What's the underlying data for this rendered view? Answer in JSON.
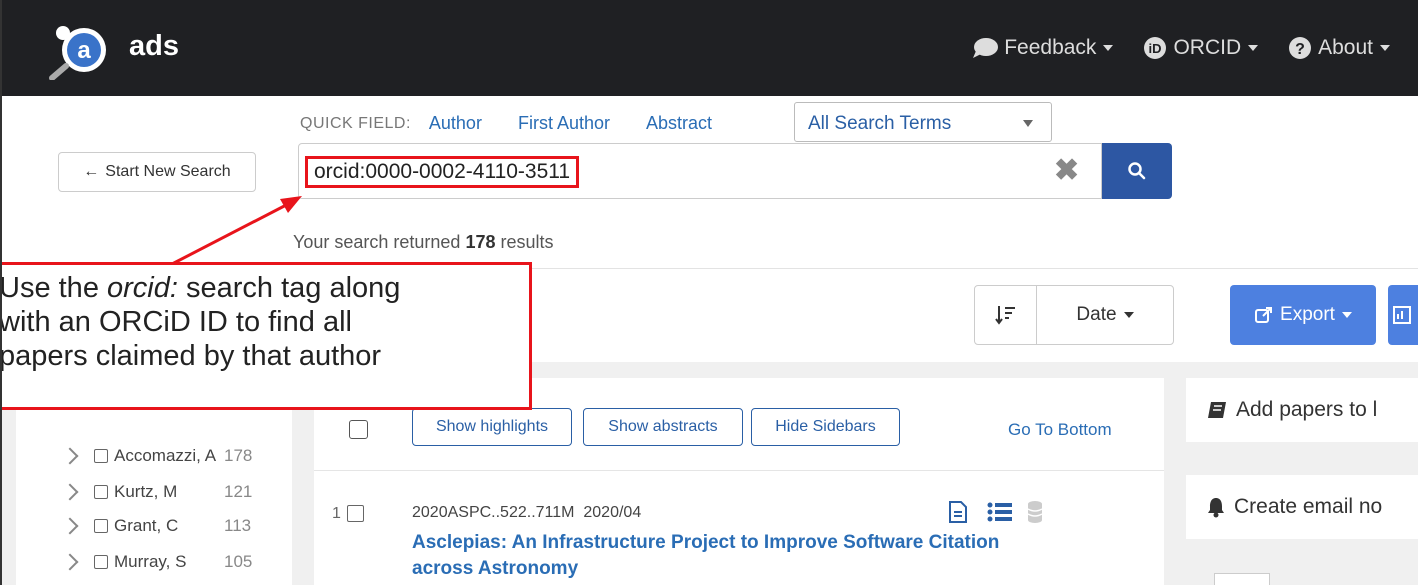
{
  "nav": {
    "logo_text": "ads",
    "feedback": "Feedback",
    "orcid": "ORCID",
    "about": "About"
  },
  "search": {
    "quick_label": "QUICK FIELD:",
    "quick_links": [
      "Author",
      "First Author",
      "Abstract"
    ],
    "terms_select": "All Search Terms",
    "start_new": "Start New Search",
    "query": "orcid:0000-0002-4110-3511",
    "results_prefix": "Your search returned",
    "results_count": "178",
    "results_suffix": "results"
  },
  "toolbar": {
    "sort_label": "Date",
    "export_label": "Export"
  },
  "facets": [
    {
      "name": "Accomazzi, A",
      "count": "178"
    },
    {
      "name": "Kurtz, M",
      "count": "121"
    },
    {
      "name": "Grant, C",
      "count": "113"
    },
    {
      "name": "Murray, S",
      "count": "105"
    }
  ],
  "results_panel": {
    "show_highlights": "Show highlights",
    "show_abstracts": "Show abstracts",
    "hide_sidebars": "Hide Sidebars",
    "go_to_bottom": "Go To Bottom"
  },
  "results": [
    {
      "index": "1",
      "bibcode": "2020ASPC..522..711M",
      "date": "2020/04",
      "title": "Asclepias: An Infrastructure Project to Improve Software Citation across Astronomy"
    }
  ],
  "right_panel": {
    "add_papers": "Add papers to l",
    "create_email": "Create email no"
  },
  "callout": {
    "line1_before": "Use the ",
    "line1_tag": "orcid:",
    "line1_after": " search tag along",
    "line2": "with an ORCiD ID to find all",
    "line3": "papers claimed by that author"
  },
  "colors": {
    "navbar": "#1f2023",
    "accent_blue": "#2d57a3",
    "export_blue": "#4d80e0",
    "link_blue": "#2a6db5",
    "highlight_red": "#e8141b"
  }
}
